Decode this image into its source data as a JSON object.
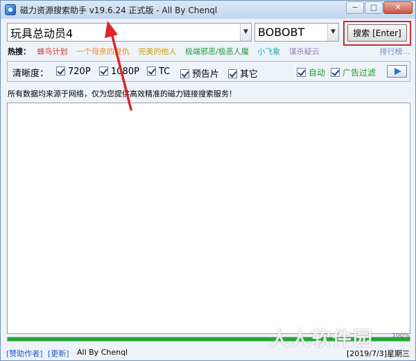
{
  "window": {
    "title": "磁力资源搜索助手 v19.6.24 正式版 - All By Chenql",
    "controls": {
      "minimize": "−",
      "maximize": "□",
      "close": "✕"
    }
  },
  "search": {
    "query": "玩具总动员4",
    "engine": "BOBOBT",
    "button_label": "搜索 [Enter]"
  },
  "hot": {
    "label": "热搜：",
    "items": [
      {
        "text": "蜂鸟计划",
        "color": "#e2302a"
      },
      {
        "text": "一个母亲的复仇",
        "color": "#f08a1c"
      },
      {
        "text": "完美的他人",
        "color": "#c9a300"
      },
      {
        "text": "极端邪恶/极恶人魔",
        "color": "#1e9b35"
      },
      {
        "text": "小飞象",
        "color": "#1aa7b8"
      },
      {
        "text": "谋杀疑云",
        "color": "#9a7ac2"
      }
    ],
    "rank_link": "排行榜..."
  },
  "filters": {
    "label": "清晰度：",
    "options": [
      {
        "label": "720P",
        "checked": true
      },
      {
        "label": "1080P",
        "checked": true
      },
      {
        "label": "TC",
        "checked": true
      },
      {
        "label": "预告片",
        "checked": true
      },
      {
        "label": "其它",
        "checked": true
      }
    ],
    "auto_label": "自动",
    "adfilter_label": "广告过滤"
  },
  "notice": "所有数据均来源于网络，仅为您提供高效精准的磁力链接搜索服务！",
  "progress": {
    "percent": 100,
    "label": "100%"
  },
  "status": {
    "donate": "[赞助作者]",
    "update": "[更新]",
    "author": "All By Chenql",
    "date": "[2019/7/3]星期三"
  },
  "watermark": "人人软件园",
  "colors": {
    "highlight": "#d9262b",
    "arrow": "#d9262b",
    "progress": "#24a832",
    "link": "#1f5bc8"
  }
}
